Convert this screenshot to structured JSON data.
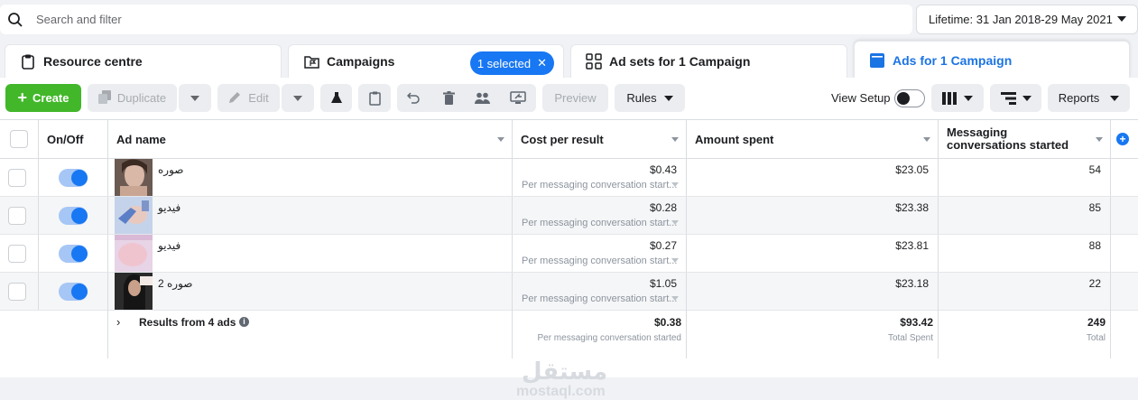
{
  "search": {
    "placeholder": "Search and filter"
  },
  "date_range": {
    "label": "Lifetime: 31 Jan 2018-29 May 2021"
  },
  "tabs": [
    {
      "label": "Resource centre"
    },
    {
      "label": "Campaigns",
      "badge": "1 selected"
    },
    {
      "label": "Ad sets for 1 Campaign"
    },
    {
      "label": "Ads for 1 Campaign"
    }
  ],
  "toolbar": {
    "create": "Create",
    "duplicate": "Duplicate",
    "edit": "Edit",
    "preview": "Preview",
    "rules": "Rules",
    "view_setup": "View Setup",
    "reports": "Reports"
  },
  "columns": {
    "on_off": "On/Off",
    "ad_name": "Ad name",
    "cost": "Cost per result",
    "spent": "Amount spent",
    "messaging": "Messaging conversations started"
  },
  "rows": [
    {
      "name": "صوره",
      "cost": "$0.43",
      "cost_sub": "Per messaging conversation start...",
      "spent": "$23.05",
      "conv": "54"
    },
    {
      "name": "فيديو",
      "cost": "$0.28",
      "cost_sub": "Per messaging conversation start...",
      "spent": "$23.38",
      "conv": "85"
    },
    {
      "name": "فيديو",
      "cost": "$0.27",
      "cost_sub": "Per messaging conversation start...",
      "spent": "$23.81",
      "conv": "88"
    },
    {
      "name": "صوره 2",
      "cost": "$1.05",
      "cost_sub": "Per messaging conversation start...",
      "spent": "$23.18",
      "conv": "22"
    }
  ],
  "totals": {
    "label": "Results from 4 ads",
    "cost": "$0.38",
    "cost_sub": "Per messaging conversation started",
    "spent": "$93.42",
    "spent_sub": "Total Spent",
    "conv": "249",
    "conv_sub": "Total"
  },
  "watermark": {
    "arabic": "مستقل",
    "latin": "mostaql.com"
  },
  "colors": {
    "accent": "#1877f2",
    "create_green": "#42b72a",
    "active_tab": "#1b74e4"
  }
}
